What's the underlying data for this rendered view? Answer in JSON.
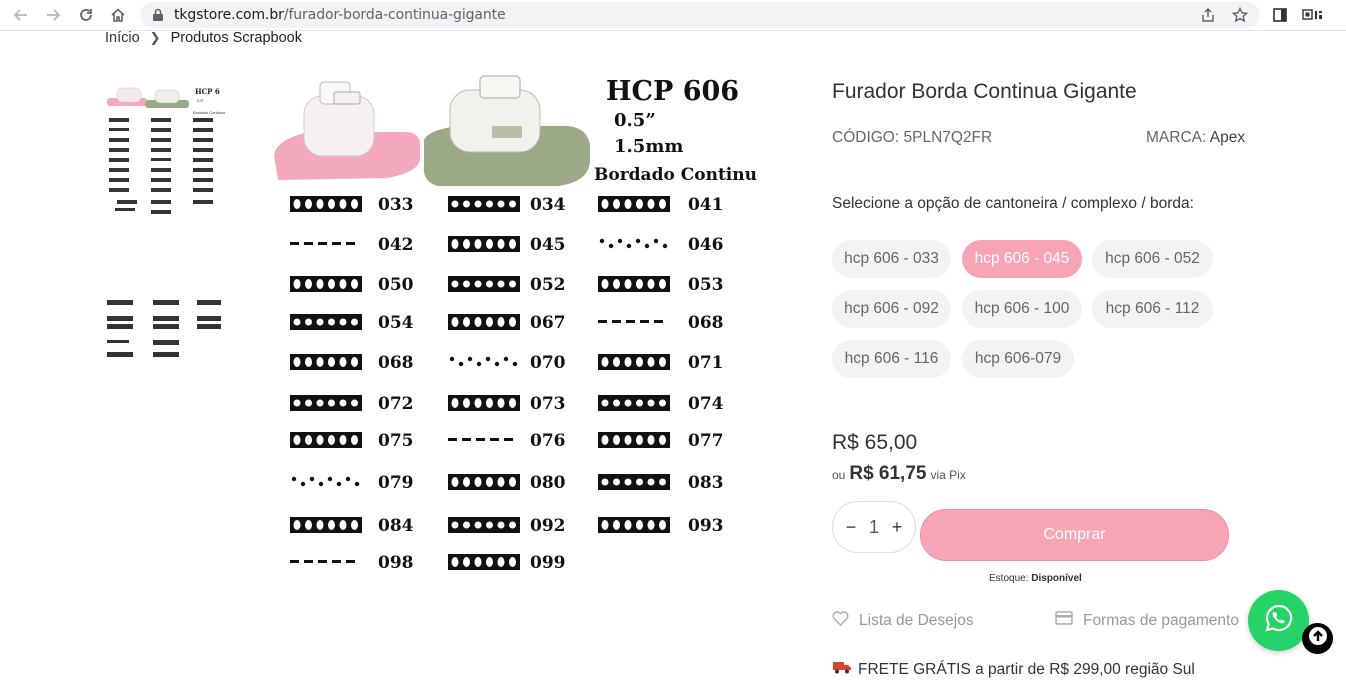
{
  "browser": {
    "url_domain": "tkgstore.com.br",
    "url_path": "/furador-borda-continua-gigante"
  },
  "breadcrumb": {
    "home": "Início",
    "category": "Produtos Scrapbook"
  },
  "product_image": {
    "model": "HCP 606",
    "size_in": "0.5”",
    "size_mm": "1.5mm",
    "subtitle": "Bordado Continuo",
    "codes": [
      "033",
      "034",
      "041",
      "042",
      "045",
      "046",
      "050",
      "052",
      "053",
      "054",
      "067",
      "068",
      "068",
      "070",
      "071",
      "072",
      "073",
      "074",
      "075",
      "076",
      "077",
      "079",
      "080",
      "083",
      "084",
      "092",
      "093",
      "098",
      "099"
    ]
  },
  "thumbnail_2": {
    "codes": [
      "100",
      "101",
      "102",
      "106",
      "107",
      "108",
      "110",
      "111",
      "112",
      "115",
      "116",
      "117"
    ]
  },
  "product": {
    "title": "Furador Borda Continua Gigante",
    "sku_label": "CÓDIGO:",
    "sku_value": "5PLN7Q2FR",
    "brand_label": "MARCA:",
    "brand_value": "Apex",
    "option_label": "Selecione a opção de cantoneira / complexo / borda:",
    "options": [
      "hcp 606 - 033",
      "hcp 606 - 045",
      "hcp 606 - 052",
      "hcp 606 - 092",
      "hcp 606 - 100",
      "hcp 606 - 112",
      "hcp 606 - 116",
      "hcp 606-079"
    ],
    "selected_option": "hcp 606 - 045",
    "price": "R$ 65,00",
    "pix_prefix": "ou",
    "pix_price": "R$ 61,75",
    "pix_suffix": "via Pix",
    "quantity": "1",
    "quantity_minus": "−",
    "quantity_plus": "+",
    "buy_label": "Comprar",
    "stock_label": "Estoque:",
    "stock_value": "Disponível",
    "wishlist_label": "Lista de Desejos",
    "payment_label": "Formas de pagamento",
    "shipping_text": "FRETE GRÁTIS a partir de R$ 299,00 região Sul"
  },
  "colors": {
    "accent": "#f7a5b4",
    "whatsapp": "#25d366"
  }
}
